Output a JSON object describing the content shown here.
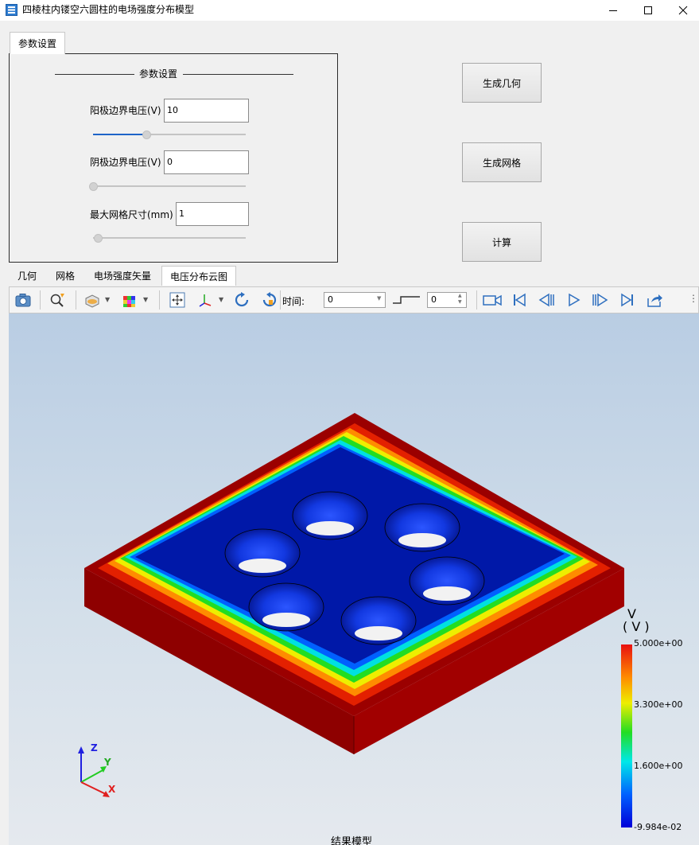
{
  "window": {
    "title": "四棱柱内镂空六圆柱的电场强度分布模型"
  },
  "param_tab": {
    "label": "参数设置"
  },
  "param_group": {
    "title": "参数设置",
    "anode": {
      "label": "阳极边界电压(V)",
      "value": "10",
      "slider_fraction": 0.35
    },
    "cathode": {
      "label": "阴极边界电压(V)",
      "value": "0",
      "slider_fraction": 0.0
    },
    "mesh": {
      "label": "最大网格尺寸(mm)",
      "value": "1",
      "slider_fraction": 0.03
    }
  },
  "buttons": {
    "gen_geometry": "生成几何",
    "gen_mesh": "生成网格",
    "compute": "计算"
  },
  "result_tabs": [
    {
      "label": "几何",
      "active": false
    },
    {
      "label": "网格",
      "active": false
    },
    {
      "label": "电场强度矢量",
      "active": false
    },
    {
      "label": "电压分布云图",
      "active": true
    }
  ],
  "toolbar": {
    "time_label": "时间:",
    "time_value": "0",
    "step_value": "0",
    "icons": [
      "camera-icon",
      "zoom-fit-icon",
      "section-view-icon",
      "color-cube-icon",
      "pan-icon",
      "axes-orient-icon",
      "rotate-ccw-icon",
      "rotate-cw-icon",
      "record-icon",
      "first-frame-icon",
      "prev-frame-icon",
      "play-icon",
      "next-frame-icon",
      "last-frame-icon",
      "export-icon"
    ]
  },
  "legend": {
    "title_line1": "V",
    "title_line2": "( V )",
    "max": "5.000e+00",
    "v2": "3.300e+00",
    "v3": "1.600e+00",
    "min": "-9.984e-02",
    "colors": [
      "#ee1111",
      "#ff8800",
      "#eeee00",
      "#22dd22",
      "#00eeee",
      "#0055ff",
      "#0000d8"
    ]
  },
  "axes": {
    "x": "X",
    "y": "Y",
    "z": "Z",
    "x_color": "#e02020",
    "y_color": "#22cc22",
    "z_color": "#2020e0"
  },
  "viewport_caption": "结果模型",
  "colors": {
    "max_red": "#9b0000",
    "min_blue": "#0018a8"
  }
}
